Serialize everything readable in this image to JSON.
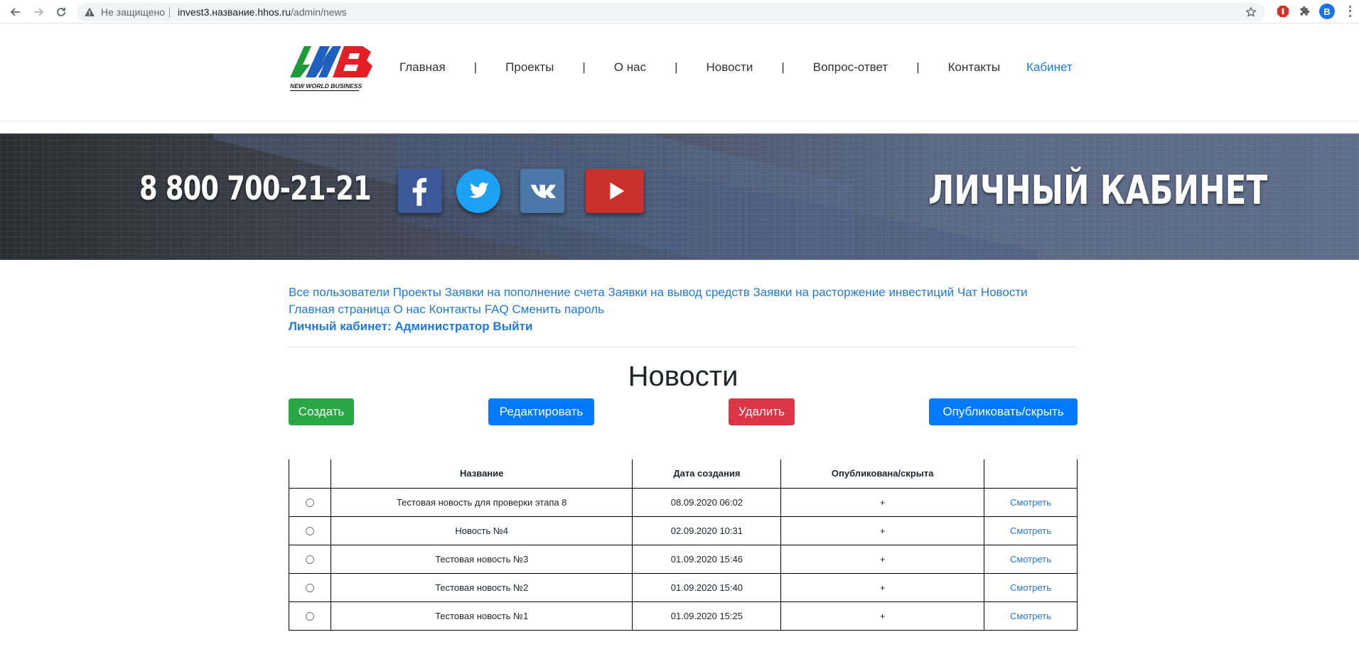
{
  "browser": {
    "security_label": "Не защищено",
    "url_host": "invest3.название.hhos.ru",
    "url_path": "/admin/news",
    "profile_letter": "B"
  },
  "header": {
    "logo_text": "NEW WORLD BUSINESS",
    "nav": [
      {
        "label": "Главная"
      },
      {
        "label": "Проекты"
      },
      {
        "label": "О нас"
      },
      {
        "label": "Новости"
      },
      {
        "label": "Вопрос-ответ"
      },
      {
        "label": "Контакты"
      },
      {
        "label": "Кабинет"
      }
    ],
    "nav_separator": "|"
  },
  "banner": {
    "phone": "8 800 700-21-21",
    "title": "ЛИЧНЫЙ КАБИНЕТ",
    "social": [
      "facebook-icon",
      "twitter-icon",
      "vk-icon",
      "youtube-icon"
    ]
  },
  "admin_menu": {
    "links": [
      "Все пользователи",
      "Проекты",
      "Заявки на пополнение счета",
      "Заявки на вывод средств",
      "Заявки на расторжение инвестиций",
      "Чат",
      "Новости",
      "Главная страница",
      "О нас",
      "Контакты",
      "FAQ",
      "Сменить пароль"
    ],
    "account_label": "Личный кабинет: Администратор",
    "logout": "Выйти"
  },
  "page": {
    "title": "Новости",
    "buttons": {
      "create": "Создать",
      "edit": "Редактировать",
      "delete": "Удалить",
      "publish": "Опубликовать/скрыть"
    }
  },
  "table": {
    "headers": [
      "",
      "Название",
      "Дата создания",
      "Опубликована/скрыта",
      ""
    ],
    "rows": [
      {
        "title": "Тестовая новость для проверки этапа 8",
        "date": "08.09.2020 06:02",
        "published": "+",
        "action": "Смотреть"
      },
      {
        "title": "Новость №4",
        "date": "02.09.2020 10:31",
        "published": "+",
        "action": "Смотреть"
      },
      {
        "title": "Тестовая новость №3",
        "date": "01.09.2020 15:46",
        "published": "+",
        "action": "Смотреть"
      },
      {
        "title": "Тестовая новость №2",
        "date": "01.09.2020 15:40",
        "published": "+",
        "action": "Смотреть"
      },
      {
        "title": "Тестовая новость №1",
        "date": "01.09.2020 15:25",
        "published": "+",
        "action": "Смотреть"
      }
    ]
  },
  "colors": {
    "link": "#1e7ae0",
    "create": "#28a745",
    "edit": "#007bff",
    "delete": "#dc3545",
    "publish": "#007bff"
  }
}
